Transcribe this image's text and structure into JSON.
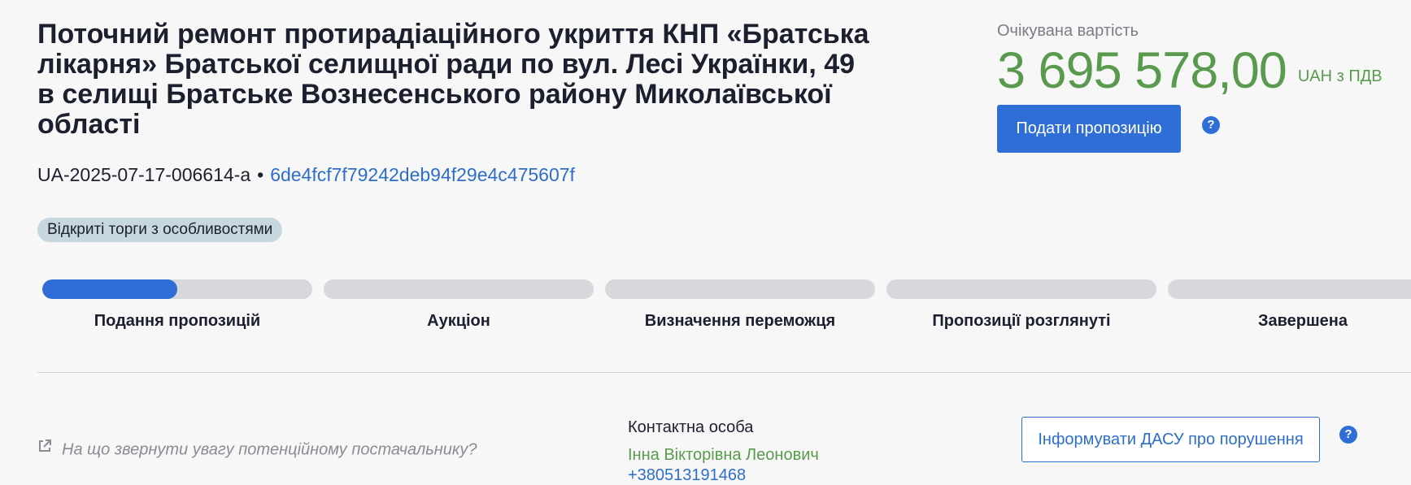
{
  "tender": {
    "title": "Поточний ремонт протирадіаційного укриття КНП «Братська лікарня» Братської селищної ради по вул. Лесі Українки, 49 в селищі Братське Вознесенського району Миколаївської області",
    "tender_id": "UA-2025-07-17-006614-a",
    "separator": "•",
    "hash": "6de4fcf7f79242deb94f29e4c475607f",
    "procedure_badge": "Відкриті торги з особливостями"
  },
  "price": {
    "label": "Очікувана вартість",
    "value": "3 695 578,00",
    "currency": "UAH з ПДВ"
  },
  "actions": {
    "submit_label": "Подати пропозицію",
    "help_glyph": "?",
    "dasu_label": "Інформувати ДАСУ про порушення"
  },
  "stages": [
    {
      "label": "Подання пропозицій",
      "progress": 0.5
    },
    {
      "label": "Аукціон",
      "progress": 0
    },
    {
      "label": "Визначення переможця",
      "progress": 0
    },
    {
      "label": "Пропозиції розглянуті",
      "progress": 0
    },
    {
      "label": "Завершена",
      "progress": 0
    }
  ],
  "hint": {
    "icon": "external-link-icon",
    "text": "На що звернути увагу потенційному постачальнику?"
  },
  "contact": {
    "label": "Контактна особа",
    "name": "Інна Вікторівна Леонович",
    "phone": "+380513191468"
  },
  "colors": {
    "accent": "#2e6ed6",
    "price": "#5a9a4e",
    "badge_bg": "#c7d7df",
    "track": "#d6d8dc"
  }
}
